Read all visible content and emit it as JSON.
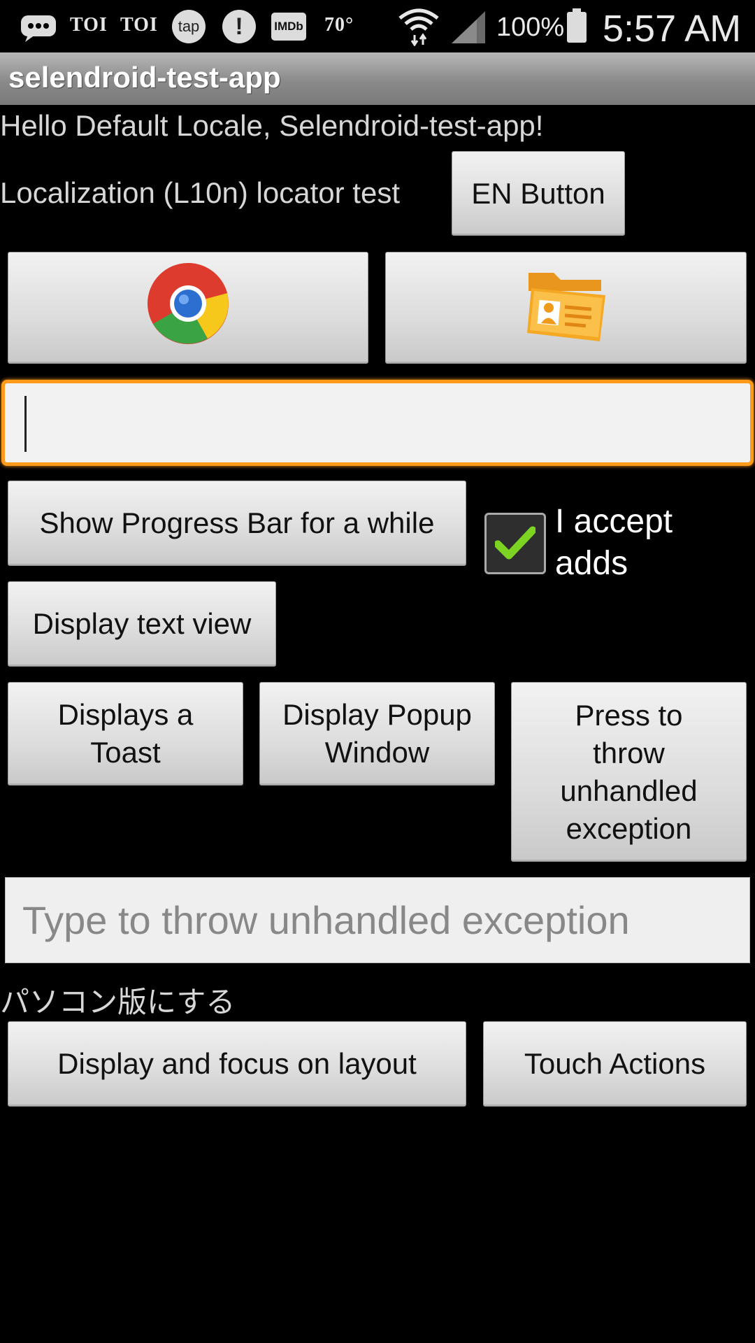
{
  "status_bar": {
    "icons": [
      "chat-icon",
      "toi-icon",
      "toi-icon",
      "tap-icon",
      "alert-icon",
      "imdb-icon",
      "weather-icon",
      "wifi-icon",
      "signal-icon",
      "battery-icon"
    ],
    "toi_1": "TOI",
    "toi_2": "TOI",
    "tap": "tap",
    "alert": "!",
    "imdb": "IMDb",
    "temperature": "70°",
    "battery": "100%",
    "time": "5:57 AM"
  },
  "app_bar": {
    "title": "selendroid-test-app"
  },
  "main": {
    "hello_text": "Hello Default Locale, Selendroid-test-app!",
    "l10n_label": "Localization (L10n) locator test",
    "en_button": "EN Button",
    "chrome_button_icon": "chrome-icon",
    "contacts_button_icon": "contact-folder-icon",
    "text_input_value": "",
    "progress_button": "Show Progress Bar for a while",
    "checkbox_label": "I accept adds",
    "checkbox_checked": true,
    "display_text_view_button": "Display text view",
    "toast_button": "Displays a Toast",
    "popup_button": "Display Popup Window",
    "exception_button": "Press to throw unhandled exception",
    "exception_input_placeholder": "Type to throw unhandled exception",
    "japanese_text": "パソコン版にする",
    "focus_layout_button": "Display and focus on layout",
    "touch_actions_button": "Touch Actions"
  },
  "colors": {
    "focus_border": "#ff9a1a",
    "checkmark": "#7cd321",
    "background": "#000000"
  }
}
